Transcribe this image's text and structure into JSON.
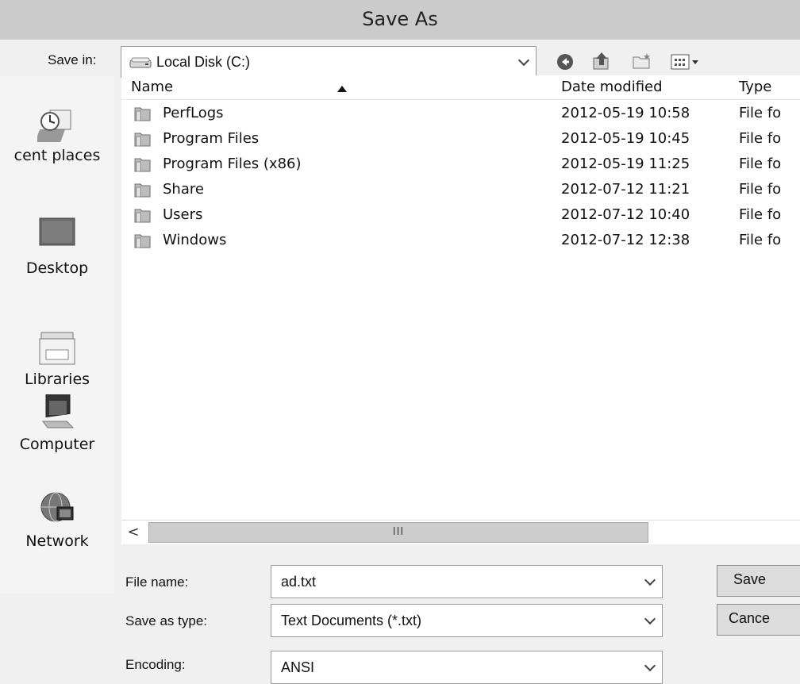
{
  "window": {
    "title": "Save As"
  },
  "save_in": {
    "label": "Save in:",
    "value": "Local Disk (C:)"
  },
  "toolbar": {
    "back": "back-icon",
    "up": "up-folder-icon",
    "new_folder": "new-folder-icon",
    "views": "views-menu-icon"
  },
  "places": [
    {
      "label": "cent places",
      "icon": "recent-places-icon"
    },
    {
      "label": "Desktop",
      "icon": "desktop-icon"
    },
    {
      "label": "Libraries",
      "icon": "libraries-icon"
    },
    {
      "label": "Computer",
      "icon": "computer-icon"
    },
    {
      "label": "Network",
      "icon": "network-icon"
    }
  ],
  "columns": {
    "name": "Name",
    "date": "Date modified",
    "type": "Type"
  },
  "files": [
    {
      "name": "PerfLogs",
      "date": "2012-05-19 10:58",
      "type": "File fo"
    },
    {
      "name": "Program Files",
      "date": "2012-05-19 10:45",
      "type": "File fo"
    },
    {
      "name": "Program Files (x86)",
      "date": "2012-05-19 11:25",
      "type": "File fo"
    },
    {
      "name": "Share",
      "date": "2012-07-12 11:21",
      "type": "File fo"
    },
    {
      "name": "Users",
      "date": "2012-07-12 10:40",
      "type": "File fo"
    },
    {
      "name": "Windows",
      "date": "2012-07-12 12:38",
      "type": "File fo"
    }
  ],
  "scrollbar": {
    "left_arrow": "<",
    "grip": "III"
  },
  "file_name": {
    "label": "File name:",
    "value": "ad.txt"
  },
  "save_as_type": {
    "label": "Save as type:",
    "value": "Text Documents (*.txt)"
  },
  "encoding": {
    "label": "Encoding:",
    "value": "ANSI"
  },
  "buttons": {
    "save": "Save",
    "cancel": "Cance"
  }
}
